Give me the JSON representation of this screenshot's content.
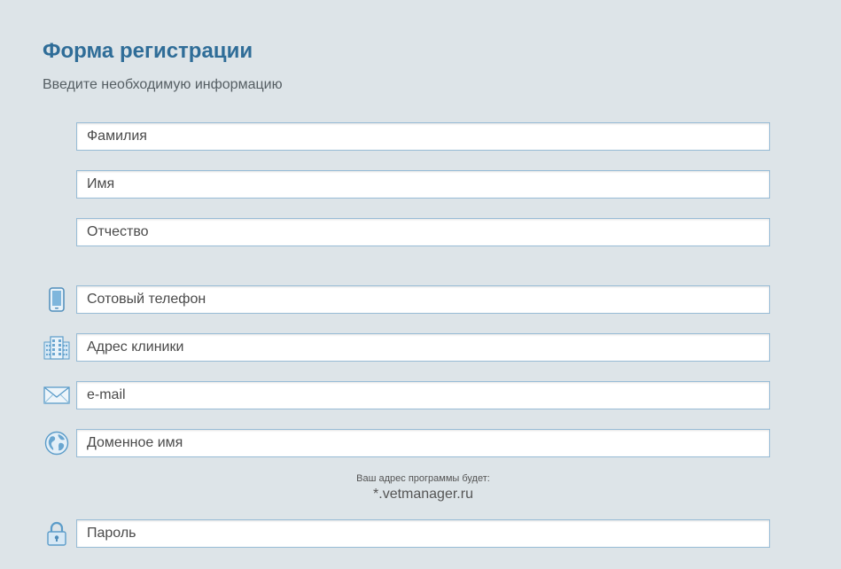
{
  "form": {
    "title": "Форма регистрации",
    "subtitle": "Введите необходимую информацию"
  },
  "fields": {
    "last_name": {
      "placeholder": "Фамилия",
      "value": ""
    },
    "first_name": {
      "placeholder": "Имя",
      "value": ""
    },
    "patronymic": {
      "placeholder": "Отчество",
      "value": ""
    },
    "phone": {
      "placeholder": "Сотовый телефон",
      "value": "",
      "icon": "mobile-phone-icon"
    },
    "clinic_address": {
      "placeholder": "Адрес клиники",
      "value": "",
      "icon": "building-icon"
    },
    "email": {
      "placeholder": "e-mail",
      "value": "",
      "icon": "envelope-icon"
    },
    "domain": {
      "placeholder": "Доменное имя",
      "value": "",
      "icon": "globe-icon"
    },
    "password": {
      "placeholder": "Пароль",
      "value": "",
      "icon": "lock-icon"
    }
  },
  "domain_hint": {
    "label": "Ваш адрес программы будет:",
    "address": "*.vetmanager.ru"
  },
  "colors": {
    "background": "#dde4e8",
    "title": "#2f6d98",
    "field_border": "#98bcd6",
    "icon_blue": "#5b9cc9"
  }
}
